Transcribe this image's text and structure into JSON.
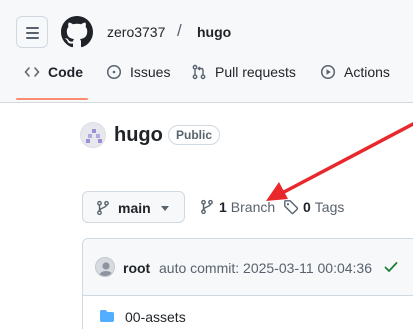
{
  "header": {
    "owner": "zero3737",
    "separator": "/",
    "repo": "hugo",
    "menu_icon": "hamburger-icon",
    "logo_icon": "github-mark-icon"
  },
  "tabs": [
    {
      "label": "Code",
      "icon": "code-icon",
      "selected": true
    },
    {
      "label": "Issues",
      "icon": "issue-opened-icon"
    },
    {
      "label": "Pull requests",
      "icon": "git-pull-request-icon"
    },
    {
      "label": "Actions",
      "icon": "play-icon"
    }
  ],
  "repo_title": {
    "name": "hugo",
    "visibility": "Public"
  },
  "branch_bar": {
    "current_branch": "main",
    "branch_count": "1",
    "branch_label": "Branch",
    "tag_count": "0",
    "tag_label": "Tags"
  },
  "latest_commit": {
    "author": "root",
    "message": "auto commit: 2025-03-11 00:04:36",
    "status": "check-icon"
  },
  "files": [
    {
      "name": "00-assets",
      "icon": "folder-icon"
    }
  ],
  "colors": {
    "accent_underline": "#fd8c73",
    "annotation_arrow": "#e8282b",
    "folder": "#54aeff",
    "success": "#1a7f37"
  }
}
